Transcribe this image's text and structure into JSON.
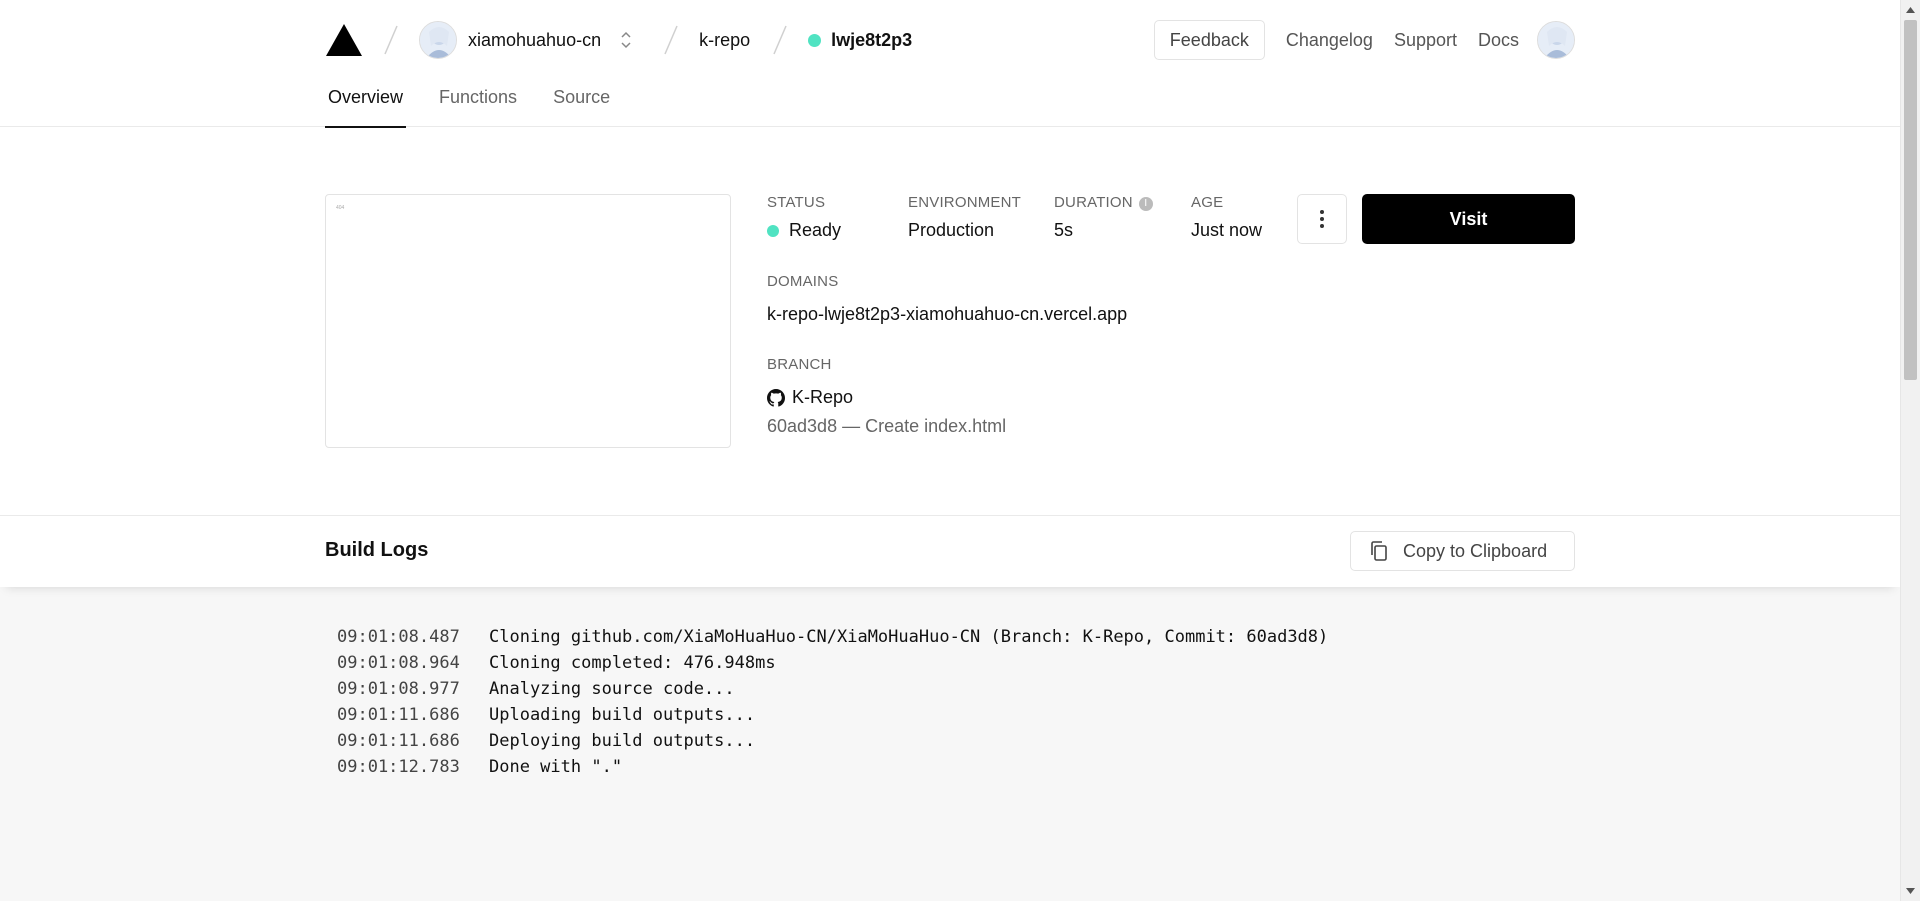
{
  "header": {
    "team_name": "xiamohuahuo-cn",
    "project_name": "k-repo",
    "deployment_id": "lwje8t2p3",
    "nav": {
      "feedback": "Feedback",
      "changelog": "Changelog",
      "support": "Support",
      "docs": "Docs"
    },
    "tabs": [
      {
        "label": "Overview",
        "active": true
      },
      {
        "label": "Functions",
        "active": false
      },
      {
        "label": "Source",
        "active": false
      }
    ]
  },
  "overview": {
    "preview_text": "404",
    "status": {
      "label": "STATUS",
      "value": "Ready",
      "color": "#50e3c2"
    },
    "environment": {
      "label": "ENVIRONMENT",
      "value": "Production"
    },
    "duration": {
      "label": "DURATION",
      "value": "5s",
      "info_icon": "i"
    },
    "age": {
      "label": "AGE",
      "value": "Just now"
    },
    "visit_label": "Visit",
    "domains": {
      "label": "DOMAINS",
      "value": "k-repo-lwje8t2p3-xiamohuahuo-cn.vercel.app"
    },
    "branch": {
      "label": "BRANCH",
      "name": "K-Repo",
      "commit": "60ad3d8 — Create index.html"
    }
  },
  "build_logs": {
    "title": "Build Logs",
    "copy_label": "Copy to Clipboard",
    "lines": [
      {
        "time": "09:01:08.487",
        "message": "Cloning github.com/XiaMoHuaHuo-CN/XiaMoHuaHuo-CN (Branch: K-Repo, Commit: 60ad3d8)"
      },
      {
        "time": "09:01:08.964",
        "message": "Cloning completed: 476.948ms"
      },
      {
        "time": "09:01:08.977",
        "message": "Analyzing source code..."
      },
      {
        "time": "09:01:11.686",
        "message": "Uploading build outputs..."
      },
      {
        "time": "09:01:11.686",
        "message": "Deploying build outputs..."
      },
      {
        "time": "09:01:12.783",
        "message": "Done with \".\""
      }
    ]
  },
  "colors": {
    "accent": "#50e3c2",
    "primary_button": "#000000"
  }
}
